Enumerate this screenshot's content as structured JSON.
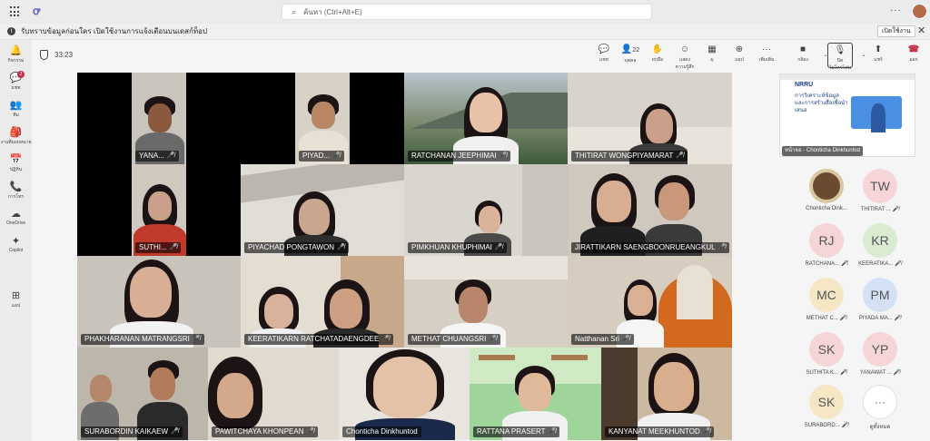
{
  "app": {
    "search_placeholder": "ค้นหา (Ctrl+Alt+E)",
    "top_more": "···"
  },
  "notice": {
    "text": "รับทราบข้อมูลก่อนใคร เปิดใช้งานการแจ้งเตือนบนเดสก์ท็อป",
    "button": "เปิดใช้งาน",
    "close": "✕"
  },
  "rail": [
    {
      "icon": "bell-icon",
      "glyph": "🔔",
      "label": "กิจกรรม"
    },
    {
      "icon": "chat-icon",
      "glyph": "💬",
      "label": "แชท",
      "badge": "2"
    },
    {
      "icon": "teams-icon",
      "glyph": "👥",
      "label": "ทีม"
    },
    {
      "icon": "assignments-icon",
      "glyph": "🎒",
      "label": "งานที่มอบหมาย"
    },
    {
      "icon": "calendar-icon",
      "glyph": "📅",
      "label": "ปฏิทิน"
    },
    {
      "icon": "calls-icon",
      "glyph": "📞",
      "label": "การโทร"
    },
    {
      "icon": "onedrive-icon",
      "glyph": "☁",
      "label": "OneDrive"
    },
    {
      "icon": "copilot-icon",
      "glyph": "✦",
      "label": "Copilot"
    },
    {
      "icon": "apps-icon",
      "glyph": "⊞",
      "label": "แอป"
    }
  ],
  "meeting": {
    "timer": "33:23",
    "tools": [
      {
        "name": "chat",
        "glyph": "💬",
        "label": "แชท"
      },
      {
        "name": "people",
        "glyph": "👤",
        "label": "บุคคล",
        "count": "22"
      },
      {
        "name": "raise-hand",
        "glyph": "✋",
        "label": "ยกมือ"
      },
      {
        "name": "react",
        "glyph": "☺",
        "label": "แสดงความรู้สึก"
      },
      {
        "name": "view",
        "glyph": "▦",
        "label": "มุ"
      },
      {
        "name": "apps",
        "glyph": "⊕",
        "label": "แอป"
      },
      {
        "name": "more",
        "glyph": "···",
        "label": "เพิ่มเติม"
      },
      {
        "name": "camera",
        "glyph": "■",
        "label": "กล้อง"
      },
      {
        "name": "mic",
        "glyph": "🎙",
        "label": "ปิดไมโครโฟน"
      },
      {
        "name": "share",
        "glyph": "⬆",
        "label": "แชร์"
      }
    ],
    "leave": {
      "glyph": "☎",
      "label": "ออก"
    }
  },
  "participants_video": [
    "YANA...",
    "PIYAD...",
    "RATCHANAN JEEPHIMAI",
    "THITIRAT WONGPIYAMARAT",
    "SUTHI...",
    "PIYACHAD PONGTAWON",
    "PIMKHUAN KHUPHIMAI",
    "JIRATTIKARN SAENGBOONRUEANGKUL",
    "PHAKHARANAN MATRANGSRI",
    "KEERATIKARN RATCHATADAENGDEE",
    "METHAT CHUANGSRI",
    "Natthanan Sri",
    "SURABORDIN KAIKAEW",
    "PAWITCHAYA KHONPEAN",
    "Chonticha Dinkhuntod",
    "RATTANA  PRASERT",
    "KANYANAT MEEKHUNTOD"
  ],
  "share": {
    "title": "NRRU",
    "subtitle": "การวิเคราะห์ข้อมูล และการสร้างสื่อเพื่อนำเสนอ",
    "label": "หน้าจอ - Chonticha Dinkhuntod"
  },
  "side_people": [
    {
      "initials": "",
      "name": "Chonticha Dink...",
      "color": "#e8e8e8"
    },
    {
      "initials": "TW",
      "name": "THITIRAT ...",
      "color": "#f6d5d8"
    },
    {
      "initials": "RJ",
      "name": "RATCHANA...",
      "color": "#f6d5d8"
    },
    {
      "initials": "KR",
      "name": "KEERATIKA...",
      "color": "#d9ecd2"
    },
    {
      "initials": "MC",
      "name": "METHAT C...",
      "color": "#f5e6c4"
    },
    {
      "initials": "PM",
      "name": "PIYADA MA...",
      "color": "#d4e1f5"
    },
    {
      "initials": "SK",
      "name": "SUTHITA K...",
      "color": "#f6d5d8"
    },
    {
      "initials": "YP",
      "name": "YANAWAT ...",
      "color": "#f6d5d8"
    },
    {
      "initials": "SK",
      "name": "SURABORD...",
      "color": "#f5e6c4"
    },
    {
      "initials": "···",
      "name": "ดูทั้งหมด",
      "color": "#ffffff"
    }
  ]
}
